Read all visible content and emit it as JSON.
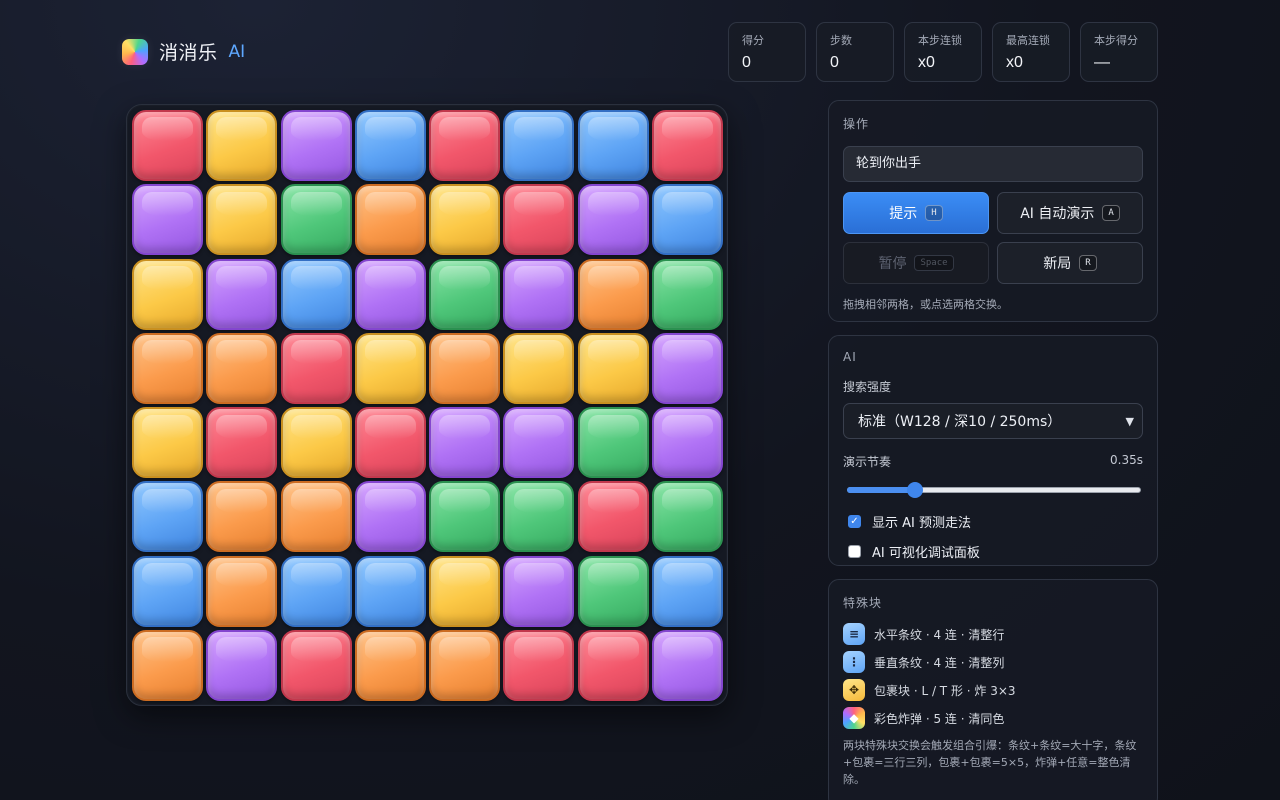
{
  "brand": {
    "name": "消消乐",
    "ai": "AI"
  },
  "stats": [
    {
      "label": "得分",
      "value": "0"
    },
    {
      "label": "步数",
      "value": "0"
    },
    {
      "label": "本步连锁",
      "value": "x0"
    },
    {
      "label": "最高连锁",
      "value": "x0"
    },
    {
      "label": "本步得分",
      "value": "—"
    }
  ],
  "colors": {
    "red": "#f2576b",
    "yellow": "#fcc947",
    "purple": "#b072f5",
    "blue": "#5ea4f5",
    "green": "#4fc77a",
    "orange": "#fb9b4c",
    "accent": "#3b8df5"
  },
  "board": [
    [
      "red",
      "yellow",
      "purple",
      "blue",
      "red",
      "blue",
      "blue",
      "red"
    ],
    [
      "purple",
      "yellow",
      "green",
      "orange",
      "yellow",
      "red",
      "purple",
      "blue"
    ],
    [
      "yellow",
      "purple",
      "blue",
      "purple",
      "green",
      "purple",
      "orange",
      "green"
    ],
    [
      "orange",
      "orange",
      "red",
      "yellow",
      "orange",
      "yellow",
      "yellow",
      "purple"
    ],
    [
      "yellow",
      "red",
      "yellow",
      "red",
      "purple",
      "purple",
      "green",
      "purple"
    ],
    [
      "blue",
      "orange",
      "orange",
      "purple",
      "green",
      "green",
      "red",
      "green"
    ],
    [
      "blue",
      "orange",
      "blue",
      "blue",
      "yellow",
      "purple",
      "green",
      "blue"
    ],
    [
      "orange",
      "purple",
      "red",
      "orange",
      "orange",
      "red",
      "red",
      "purple"
    ]
  ],
  "ops": {
    "title": "操作",
    "status": "轮到你出手",
    "hint_btn": {
      "label": "提示",
      "key": "H"
    },
    "auto_btn": {
      "label": "AI 自动演示",
      "key": "A"
    },
    "pause_btn": {
      "label": "暂停",
      "key": "Space"
    },
    "new_btn": {
      "label": "新局",
      "key": "R"
    },
    "help": "拖拽相邻两格，或点选两格交换。"
  },
  "ai": {
    "title": "AI",
    "strength_label": "搜索强度",
    "strength_value": "标准（W128 / 深10 / 250ms）",
    "tempo_label": "演示节奏",
    "tempo_value": "0.35s",
    "tempo_fraction": 0.23,
    "show_prediction": {
      "label": "显示 AI 预测走法",
      "checked": true
    },
    "debug_panel": {
      "label": "AI 可视化调试面板",
      "checked": false
    }
  },
  "specials": {
    "title": "特殊块",
    "items": [
      {
        "icon": "horizontal-stripe-icon",
        "glyph": "≡",
        "text": "水平条纹 · 4 连 · 清整行"
      },
      {
        "icon": "vertical-stripe-icon",
        "glyph": "⋮",
        "text": "垂直条纹 · 4 连 · 清整列"
      },
      {
        "icon": "wrapped-icon",
        "glyph": "✥",
        "text": "包裹块 · L / T 形 · 炸 3×3"
      },
      {
        "icon": "color-bomb-icon",
        "glyph": "◆",
        "text": "彩色炸弹 · 5 连 · 清同色"
      }
    ],
    "note": "两块特殊块交换会触发组合引爆：条纹+条纹=大十字，条纹+包裹=三行三列，包裹+包裹=5×5，炸弹+任意=整色清除。"
  }
}
